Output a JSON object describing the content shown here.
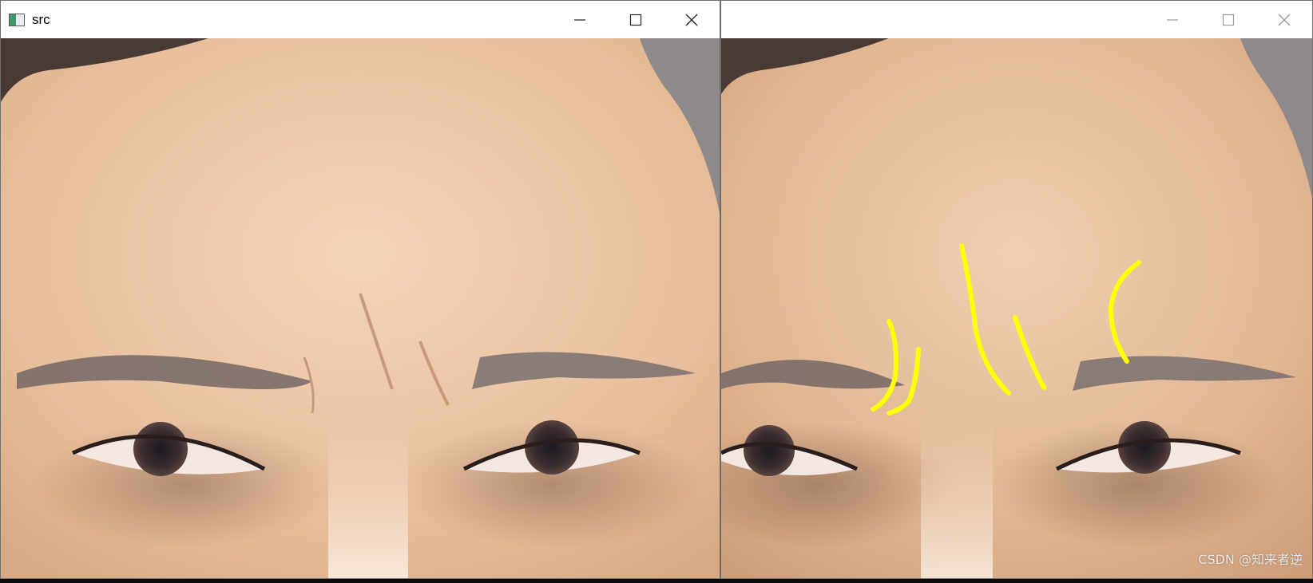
{
  "windows": [
    {
      "title": "src",
      "active": true,
      "controls": [
        "minimize-icon",
        "maximize-icon",
        "close-icon"
      ]
    },
    {
      "title": "",
      "active": false,
      "controls": [
        "minimize-icon",
        "maximize-icon",
        "close-icon"
      ]
    }
  ],
  "watermark": "CSDN @知来者逆",
  "colors": {
    "skin": "#e8bf9e",
    "skin_light": "#f2d4b6",
    "brow": "#7d6f6c",
    "annotation": "#ffff00"
  }
}
